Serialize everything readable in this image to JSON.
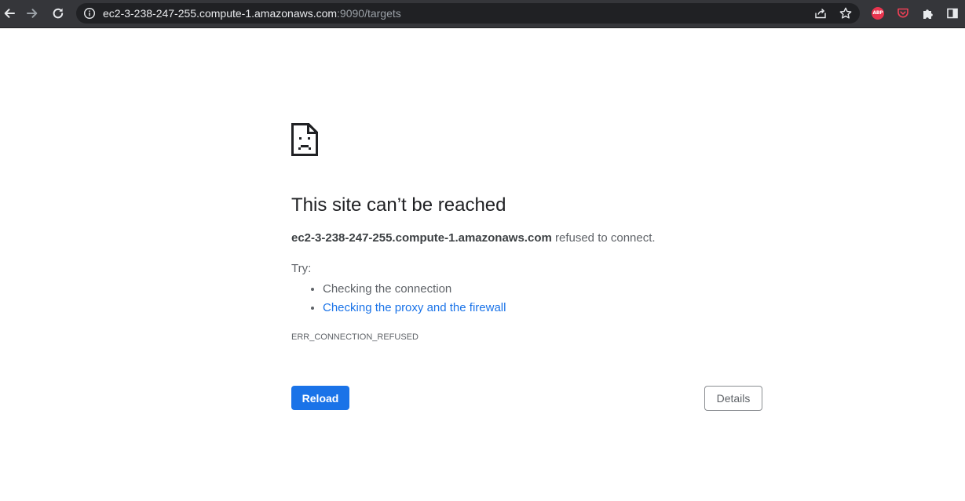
{
  "browser": {
    "address_bar": {
      "host": "ec2-3-238-247-255.compute-1.amazonaws.com",
      "path": ":9090/targets"
    },
    "icons": {
      "back": "back-arrow-icon",
      "forward": "forward-arrow-icon",
      "reload": "reload-icon",
      "site_info": "info-icon",
      "share": "share-icon",
      "bookmark": "star-icon",
      "adblock": "adblock-plus-icon",
      "pocket": "pocket-icon",
      "extensions": "puzzle-icon",
      "side_panel": "side-panel-icon"
    },
    "adblock_label": "ABP"
  },
  "error_page": {
    "heading": "This site can’t be reached",
    "host": "ec2-3-238-247-255.compute-1.amazonaws.com",
    "summary_suffix": " refused to connect.",
    "try_label": "Try:",
    "suggestions": [
      "Checking the connection",
      "Checking the proxy and the firewall"
    ],
    "error_code": "ERR_CONNECTION_REFUSED",
    "reload_label": "Reload",
    "details_label": "Details"
  },
  "colors": {
    "toolbar_bg": "#35363a",
    "omnibox_bg": "#202124",
    "link_blue": "#1a73e8",
    "primary_button": "#1a73e8",
    "adblock_red": "#e8344e",
    "pocket_red": "#ef4056"
  }
}
